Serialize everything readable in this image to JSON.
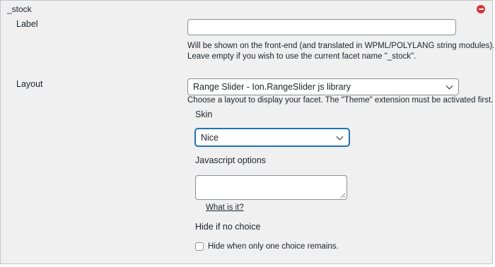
{
  "facet": {
    "name": "_stock"
  },
  "label_row": {
    "label": "Label",
    "input_value": "",
    "help_line1": "Will be shown on the front-end (and translated in WPML/POLYLANG string modules).",
    "help_line2": "Leave empty if you wish to use the current facet name \"_stock\"."
  },
  "layout_row": {
    "label": "Layout",
    "selected": "Range Slider - Ion.RangeSlider js library",
    "help": "Choose a layout to display your facet. The \"Theme\" extension must be activated first."
  },
  "skin": {
    "label": "Skin",
    "selected": "Nice"
  },
  "js_options": {
    "label": "Javascript options",
    "value": "",
    "link_text": "What is it?"
  },
  "hide_if_no_choice": {
    "label": "Hide if no choice",
    "checkbox_label": "Hide when only one choice remains.",
    "checked": false
  },
  "colors": {
    "panel_bg": "#f0f0f1",
    "border": "#c3c4c7",
    "remove_red": "#d63638",
    "focus_blue": "#2271b1"
  },
  "icons": {
    "remove": "minus-circle-icon",
    "dropdown": "chevron-down-icon"
  }
}
